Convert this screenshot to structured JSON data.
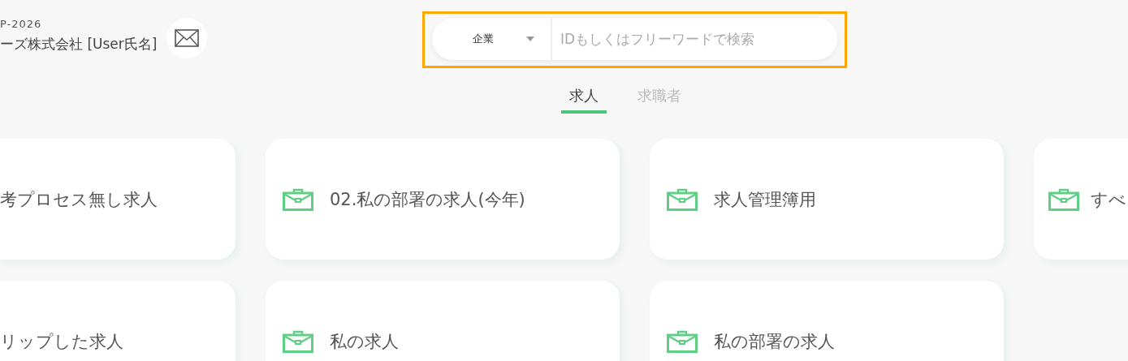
{
  "user": {
    "code": "P-2026",
    "name": "ーズ株式会社 [User氏名]"
  },
  "search": {
    "category": "企業",
    "placeholder": "IDもしくはフリーワードで検索"
  },
  "tabs": [
    {
      "label": "求人",
      "selected": true
    },
    {
      "label": "求職者",
      "selected": false
    }
  ],
  "cards": [
    {
      "title": "考プロセス無し求人",
      "kind": "cut_left"
    },
    {
      "title": "02.私の部署の求人(今年)",
      "kind": "full"
    },
    {
      "title": "求人管理簿用",
      "kind": "full"
    },
    {
      "title": "すべ",
      "kind": "cut_right"
    },
    {
      "title": "リップした求人",
      "kind": "cut_left"
    },
    {
      "title": "私の求人",
      "kind": "full"
    },
    {
      "title": "私の部署の求人",
      "kind": "full"
    }
  ]
}
